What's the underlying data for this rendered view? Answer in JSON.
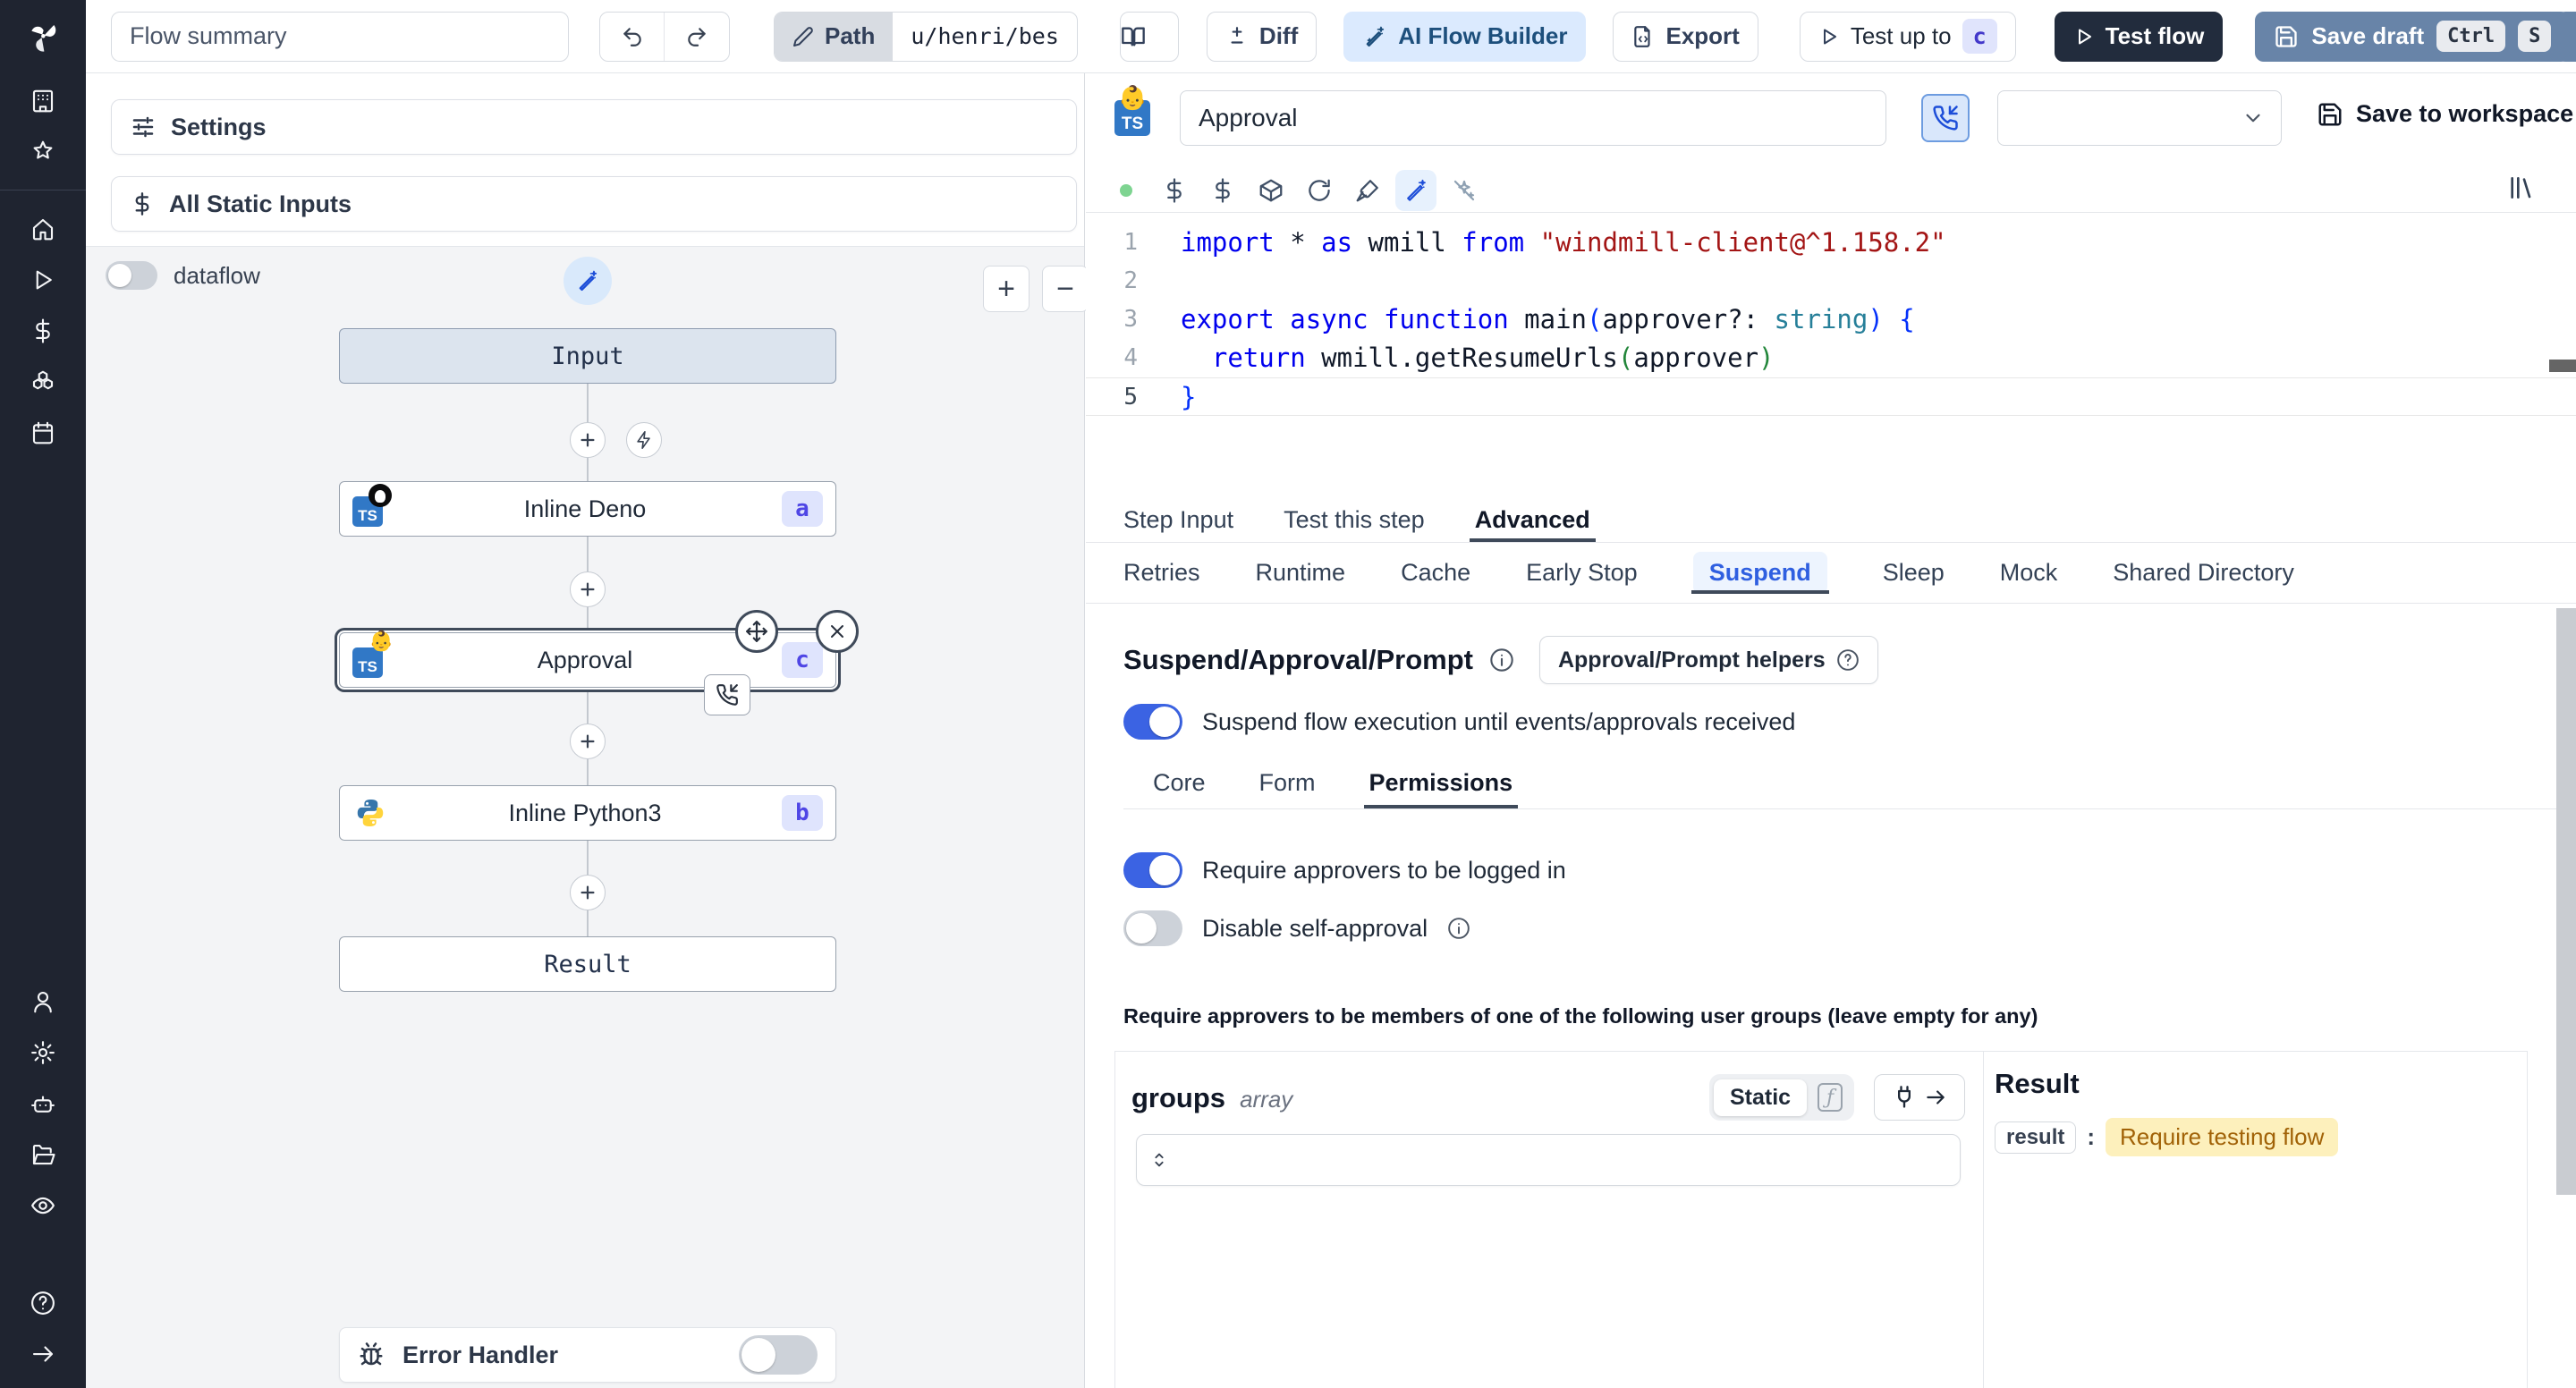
{
  "colors": {
    "accent_blue": "#3b63e3",
    "brand_dark": "#1f2430",
    "ai_btn_bg": "#dbeafe",
    "save_draft_bg": "#6884a8",
    "badge_bg": "#dfe4fd",
    "badge_text": "#4f46e5",
    "result_badge_bg": "#fdf0bc",
    "result_badge_text": "#a16207",
    "status_dot": "#7ed491"
  },
  "topbar": {
    "flow_summary_value": "Flow summary",
    "path_label": "Path",
    "path_value": "u/henri/bes",
    "diff_label": "Diff",
    "ai_flow_builder_label": "AI Flow Builder",
    "export_label": "Export",
    "test_up_to_label": "Test up to",
    "test_up_to_badge": "c",
    "test_flow_label": "Test flow",
    "save_draft_label": "Save draft",
    "save_draft_kbd1": "Ctrl",
    "save_draft_kbd2": "S"
  },
  "sidebar": {
    "icon_groups": [
      [
        "building",
        "star"
      ],
      [
        "home",
        "play",
        "dollar",
        "boxes",
        "calendar"
      ],
      [
        "user",
        "gear",
        "bot",
        "folder",
        "eye"
      ],
      [
        "help",
        "arrow-right"
      ]
    ]
  },
  "flow_panel": {
    "settings_label": "Settings",
    "static_inputs_label": "All Static Inputs",
    "dataflow_label": "dataflow",
    "zoom_in_label": "+",
    "zoom_out_label": "−",
    "error_handler_label": "Error Handler"
  },
  "graph": {
    "input_label": "Input",
    "result_label": "Result",
    "steps": [
      {
        "label": "Inline Deno",
        "badge": "a",
        "lang": "deno"
      },
      {
        "label": "Approval",
        "badge": "c",
        "lang": "approval",
        "selected": true
      },
      {
        "label": "Inline Python3",
        "badge": "b",
        "lang": "python3"
      }
    ]
  },
  "step_editor": {
    "title_value": "Approval",
    "save_to_workspace_label": "Save to workspace",
    "toolbar_icons": [
      "status-dot",
      "dollar",
      "dollar",
      "package",
      "rotate",
      "paintbrush",
      "wand",
      "sparkles-off"
    ],
    "code": {
      "language": "typescript",
      "lines": [
        {
          "n": "1",
          "tokens": [
            [
              "kw",
              "import"
            ],
            [
              "pl",
              " * "
            ],
            [
              "kw",
              "as"
            ],
            [
              "pl",
              " wmill "
            ],
            [
              "kw",
              "from"
            ],
            [
              "pl",
              " "
            ],
            [
              "st",
              "\"windmill-client@^1.158.2\""
            ]
          ]
        },
        {
          "n": "2",
          "tokens": []
        },
        {
          "n": "3",
          "tokens": [
            [
              "kw",
              "export"
            ],
            [
              "pl",
              " "
            ],
            [
              "kw",
              "async"
            ],
            [
              "pl",
              " "
            ],
            [
              "kw",
              "function"
            ],
            [
              "pl",
              " main"
            ],
            [
              "b1",
              "("
            ],
            [
              "pl",
              "approver?: "
            ],
            [
              "ty",
              "string"
            ],
            [
              "b1",
              ")"
            ],
            [
              "pl",
              " "
            ],
            [
              "b1",
              "{"
            ]
          ]
        },
        {
          "n": "4",
          "tokens": [
            [
              "pl",
              "  "
            ],
            [
              "kw",
              "return"
            ],
            [
              "pl",
              " wmill.getResumeUrls"
            ],
            [
              "b2",
              "("
            ],
            [
              "pl",
              "approver"
            ],
            [
              "b2",
              ")"
            ]
          ]
        },
        {
          "n": "5",
          "tokens": [
            [
              "b1",
              "}"
            ]
          ],
          "current": true
        }
      ]
    },
    "tabs": [
      {
        "label": "Step Input"
      },
      {
        "label": "Test this step"
      },
      {
        "label": "Advanced",
        "active": true
      }
    ],
    "advanced_tabs": [
      {
        "label": "Retries"
      },
      {
        "label": "Runtime"
      },
      {
        "label": "Cache"
      },
      {
        "label": "Early Stop"
      },
      {
        "label": "Suspend",
        "active": true
      },
      {
        "label": "Sleep"
      },
      {
        "label": "Mock"
      },
      {
        "label": "Shared Directory"
      }
    ],
    "suspend": {
      "heading": "Suspend/Approval/Prompt",
      "helpers_button_label": "Approval/Prompt helpers",
      "suspend_toggle_label": "Suspend flow execution until events/approvals received",
      "suspend_toggle_on": true,
      "sub_tabs": [
        {
          "label": "Core"
        },
        {
          "label": "Form"
        },
        {
          "label": "Permissions",
          "active": true
        }
      ],
      "require_logged_in_label": "Require approvers to be logged in",
      "require_logged_in_on": true,
      "disable_self_approval_label": "Disable self-approval",
      "disable_self_approval_on": false,
      "groups_note": "Require approvers to be members of one of the following user groups (leave empty for any)",
      "groups_field": {
        "name": "groups",
        "type": "array",
        "static_label": "Static"
      }
    },
    "result_panel": {
      "heading": "Result",
      "key": "result",
      "value": "Require testing flow"
    }
  }
}
